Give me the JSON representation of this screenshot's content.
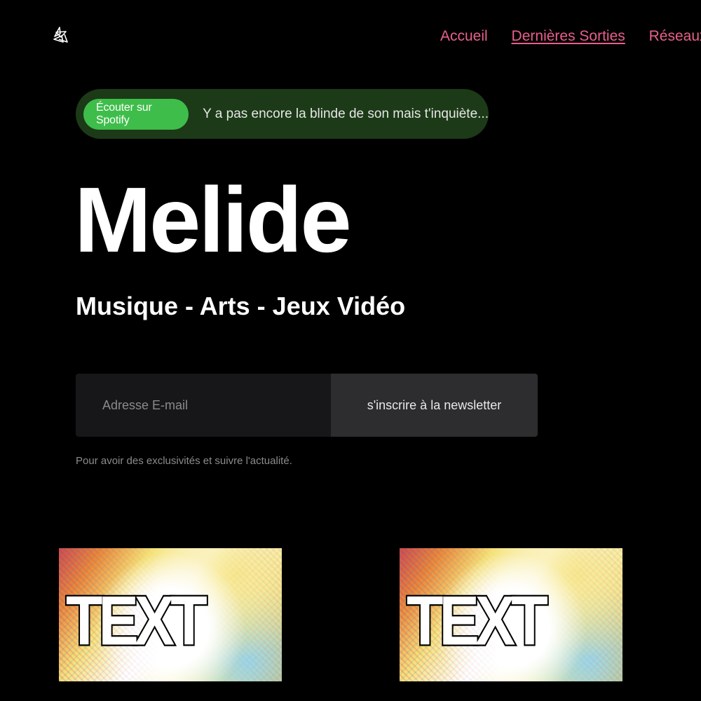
{
  "header": {
    "logo_icon": "stylized-logo-icon",
    "nav": [
      {
        "label": "Accueil",
        "active": false
      },
      {
        "label": "Dernières Sorties",
        "active": true
      },
      {
        "label": "Réseaux So",
        "active": false
      }
    ]
  },
  "spotify_banner": {
    "button_label": "Écouter sur Spotify",
    "message": "Y a pas encore la blinde de son mais t'inquiète...",
    "colors": {
      "background": "#1c3a17",
      "button": "#3ebd4a"
    }
  },
  "hero": {
    "title": "Melide",
    "subtitle": "Musique - Arts - Jeux Vidéo"
  },
  "newsletter": {
    "email_placeholder": "Adresse E-mail",
    "email_value": "",
    "submit_label": "s'inscrire à la newsletter",
    "hint": "Pour avoir des exclusivités et suivre l'actualité."
  },
  "cards": [
    {
      "image_text": "TEXT"
    },
    {
      "image_text": "TEXT"
    }
  ],
  "colors": {
    "background": "#000000",
    "nav_link": "#e8608a",
    "text_primary": "#ffffff",
    "text_muted": "#8c8c8c"
  }
}
